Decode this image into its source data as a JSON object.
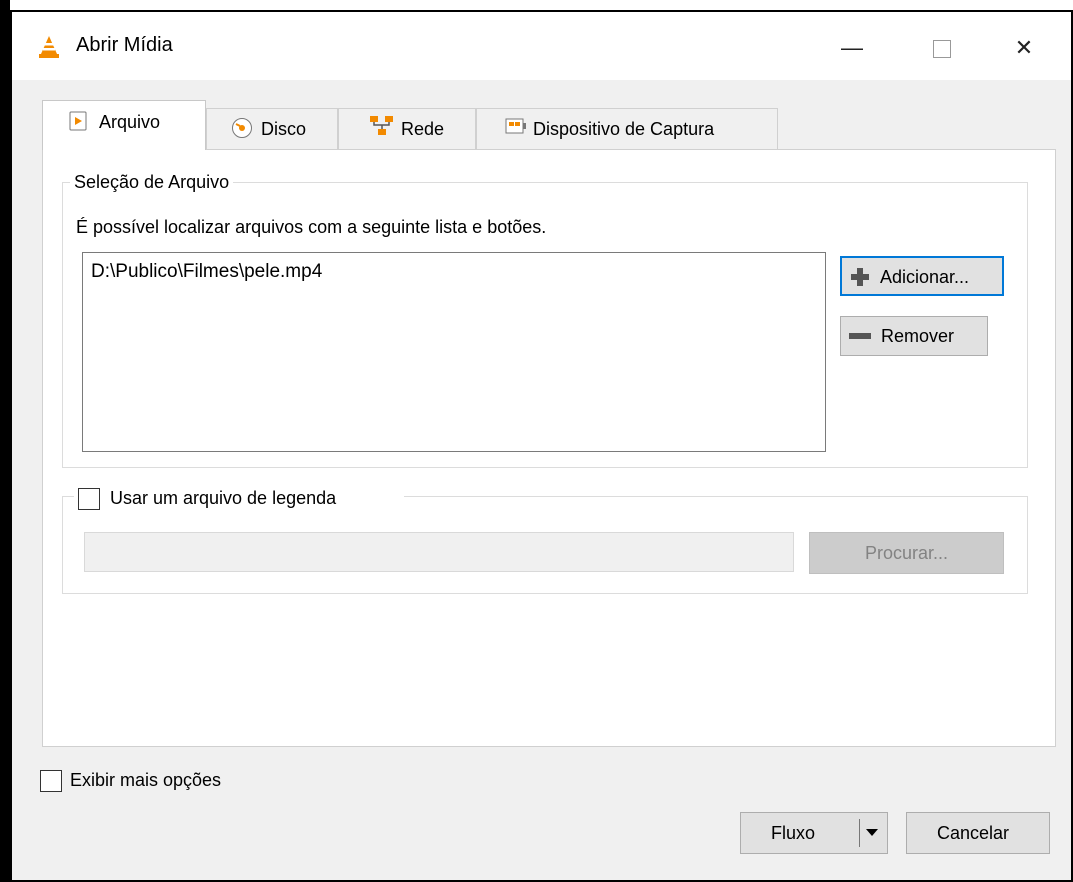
{
  "window": {
    "title": "Abrir Mídia",
    "minimize_glyph": "—",
    "close_glyph": "✕"
  },
  "tabs": [
    {
      "label": "Arquivo",
      "icon": "play-file-icon",
      "active": true
    },
    {
      "label": "Disco",
      "icon": "disc-icon",
      "active": false
    },
    {
      "label": "Rede",
      "icon": "network-icon",
      "active": false
    },
    {
      "label": "Dispositivo de Captura",
      "icon": "capture-device-icon",
      "active": false
    }
  ],
  "file_selection": {
    "group_label": "Seleção de Arquivo",
    "description": "É possível localizar arquivos com a seguinte lista e botões.",
    "files": [
      "D:\\Publico\\Filmes\\pele.mp4"
    ],
    "add_button": "Adicionar...",
    "remove_button": "Remover"
  },
  "subtitle": {
    "checkbox_label": "Usar um arquivo de legenda",
    "checked": false,
    "path_value": "",
    "browse_button": "Procurar..."
  },
  "more_options": {
    "checkbox_label": "Exibir mais opções",
    "checked": false
  },
  "footer": {
    "primary_button": "Fluxo",
    "cancel_button": "Cancelar"
  },
  "colors": {
    "accent": "#0078d7",
    "vlc_orange": "#f28a00",
    "window_bg": "#f0f0f0"
  }
}
